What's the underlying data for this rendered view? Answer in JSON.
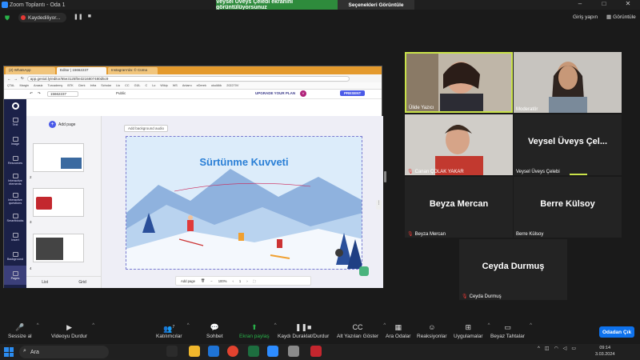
{
  "window": {
    "title": "Zoom Toplantı - Oda 1",
    "controls": [
      "–",
      "□",
      "✕"
    ]
  },
  "banner": {
    "sharing_text": "Veysel Üveys Çelebi ekranını görüntülüyorsunuz",
    "options_label": "Seçenekleri Görüntüle"
  },
  "topbar": {
    "recording_text": "Kaydediliyor...",
    "join_label": "Giriş yapın",
    "view_label": "Görüntüle"
  },
  "browser": {
    "tabs": [
      "(2) WhatsApp",
      "Editor | 15662237",
      "Instagram'da: © Cüma"
    ],
    "url": "app.genial.ly/editor/65e3125f0e3216807480d5c9",
    "bookmarks": [
      "ÇTAL",
      "Margin",
      "Anasiz",
      "Turcademy",
      "BTK",
      "Clerk",
      "Infra",
      "Scholar",
      "Lio",
      "CC",
      "GÜL",
      "C",
      "Lo",
      "Wikip",
      "WS",
      "Anlamı",
      "eDerek",
      "okulAtik",
      "202270V"
    ]
  },
  "genially": {
    "title": "15662237",
    "visibility": "Public",
    "upgrade_label": "UPGRADE YOUR PLAN",
    "avatar_initial": "V",
    "present_label": "PRESENT",
    "sidebar": [
      "Text",
      "Image",
      "Resources",
      "Interactive elements",
      "Interactive questions",
      "Smartblocks",
      "Insert",
      "Background",
      "Pages"
    ],
    "add_page_label": "Add page",
    "add_audio_label": "Add background audio",
    "page_numbers": [
      "2",
      "3",
      "4"
    ],
    "view_tabs": [
      "List",
      "Grid"
    ],
    "bottom": {
      "add_page": "Add page",
      "zoom": "100%",
      "page": "1"
    }
  },
  "slide": {
    "title": "Sürtünme Kuvveti"
  },
  "participants": [
    {
      "name": "Ülide Yazıcı",
      "has_video": true,
      "muted": false,
      "speaking": true
    },
    {
      "name": "Moderatör",
      "has_video": true,
      "muted": false
    },
    {
      "name": "Canan ÇOLAK YAKAR",
      "has_video": true,
      "muted": true
    },
    {
      "name": "Veysel Üveys Çelebi",
      "big": "Veysel Üveys Çel...",
      "has_video": false,
      "muted": false
    },
    {
      "name": "Beyza Mercan",
      "big": "Beyza Mercan",
      "has_video": false,
      "muted": true
    },
    {
      "name": "Berre Külsoy",
      "big": "Berre Külsoy",
      "has_video": false,
      "muted": false
    },
    {
      "name": "Ceyda Durmuş",
      "big": "Ceyda Durmuş",
      "has_video": false,
      "muted": true
    }
  ],
  "toolbar": {
    "mute": "Sessize al",
    "video": "Videoyu Durdur",
    "participants": "Katılımcılar",
    "participants_count": "7",
    "chat": "Sohbet",
    "share": "Ekran paylaş",
    "pause_record": "Kaydı Duraklat/Durdur",
    "captions": "Alt Yazıları Göster",
    "breakout": "Ara Odalar",
    "reactions": "Reaksiyonlar",
    "apps": "Uygulamalar",
    "whiteboard": "Beyaz Tahtalar",
    "leave": "Odadan Çık"
  },
  "taskbar": {
    "search_label": "Ara",
    "time": "09:14",
    "date": "3.03.2024"
  },
  "colors": {
    "share_green": "#2e8b3c",
    "speaker_border": "#c9e24a",
    "leave_blue": "#0e72ed",
    "genially_nav": "#1b2148",
    "muted_red": "#e53935"
  }
}
